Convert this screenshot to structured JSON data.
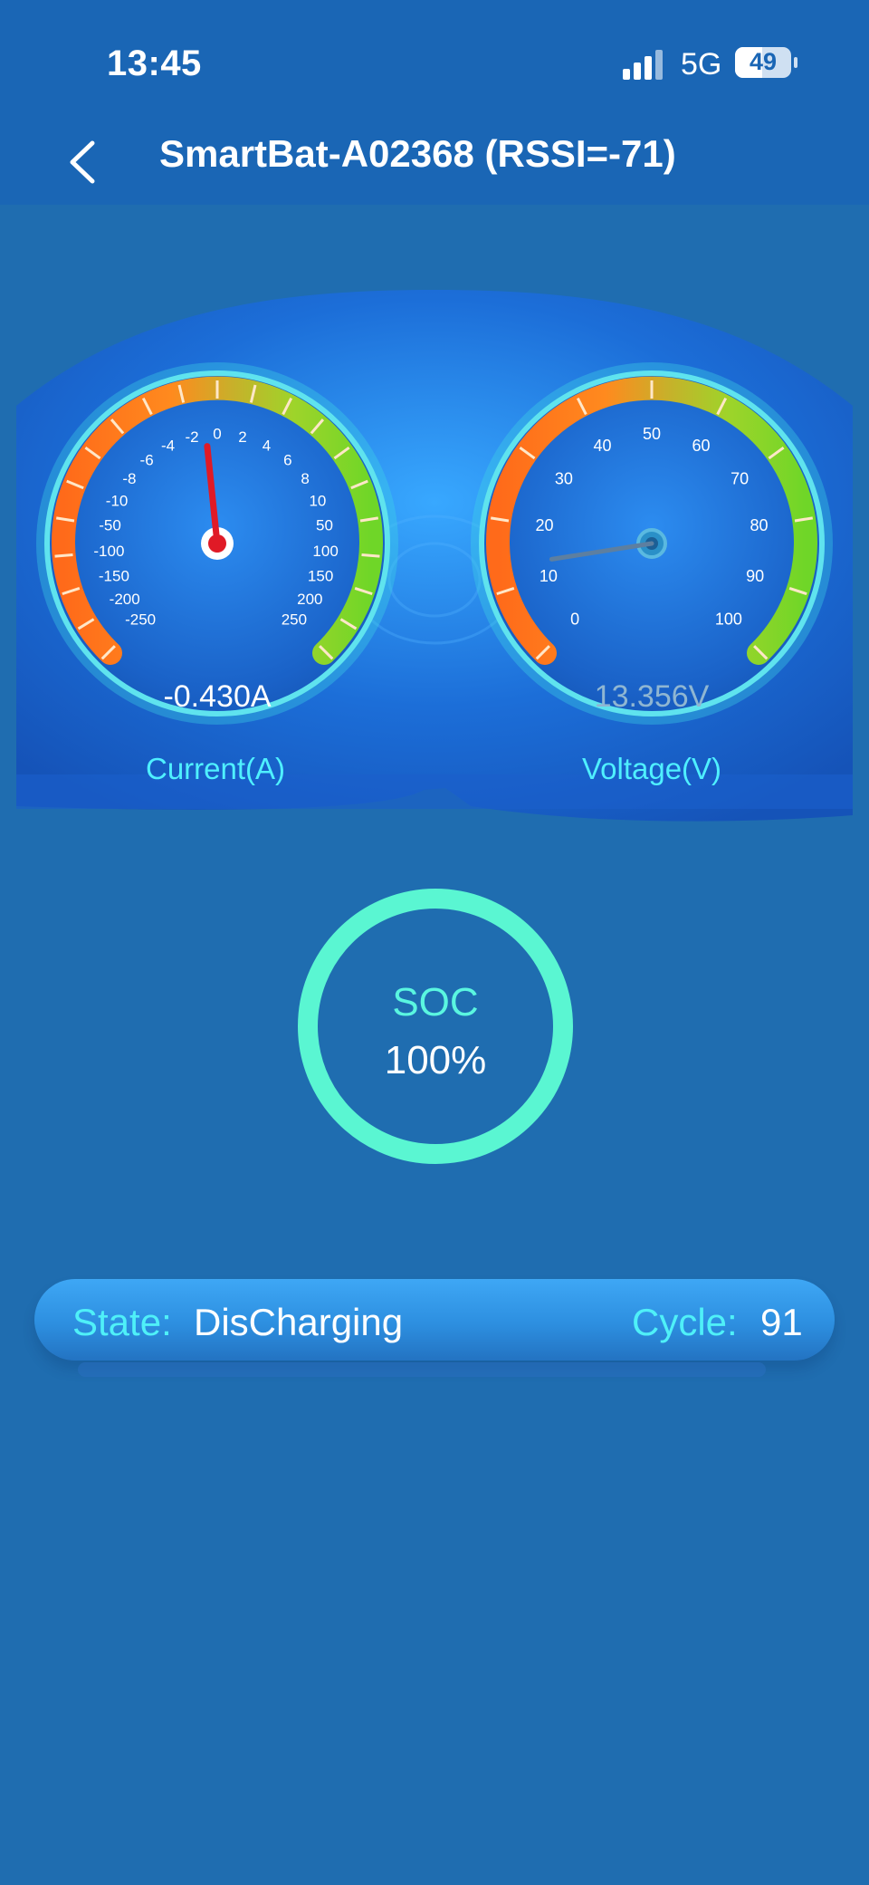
{
  "status_bar": {
    "time": "13:45",
    "network": "5G",
    "battery": "49",
    "battery_level": 0.49
  },
  "header": {
    "title": "SmartBat-A02368 (RSSI=-71)",
    "back_icon": "chevron-left-icon"
  },
  "gauges": {
    "current": {
      "label": "Current(A)",
      "value_text": "-0.430A",
      "value": -0.43,
      "ticks_left": [
        "-250",
        "-200",
        "-150",
        "-100",
        "-50",
        "-10",
        "-8",
        "-6",
        "-4",
        "-2",
        "0"
      ],
      "ticks_right": [
        "2",
        "4",
        "6",
        "8",
        "10",
        "50",
        "100",
        "150",
        "200",
        "250"
      ]
    },
    "voltage": {
      "label": "Voltage(V)",
      "value_text": "13.356V",
      "value": 13.356,
      "ticks": [
        "0",
        "10",
        "20",
        "30",
        "40",
        "50",
        "60",
        "70",
        "80",
        "90",
        "100"
      ]
    }
  },
  "soc": {
    "label": "SOC",
    "value_text": "100%",
    "percent": 100
  },
  "state_bar": {
    "state_key": "State:",
    "state_value": "DisCharging",
    "cycle_key": "Cycle:",
    "cycle_value": "91"
  },
  "colors": {
    "background": "#1f6db0",
    "header": "#1a66b5",
    "ring": "#5af6d2",
    "accent_cyan": "#4ff0ff",
    "needle_red": "#e01a26",
    "arc_orange": "#ff7a1e",
    "arc_green": "#7ad62a"
  }
}
